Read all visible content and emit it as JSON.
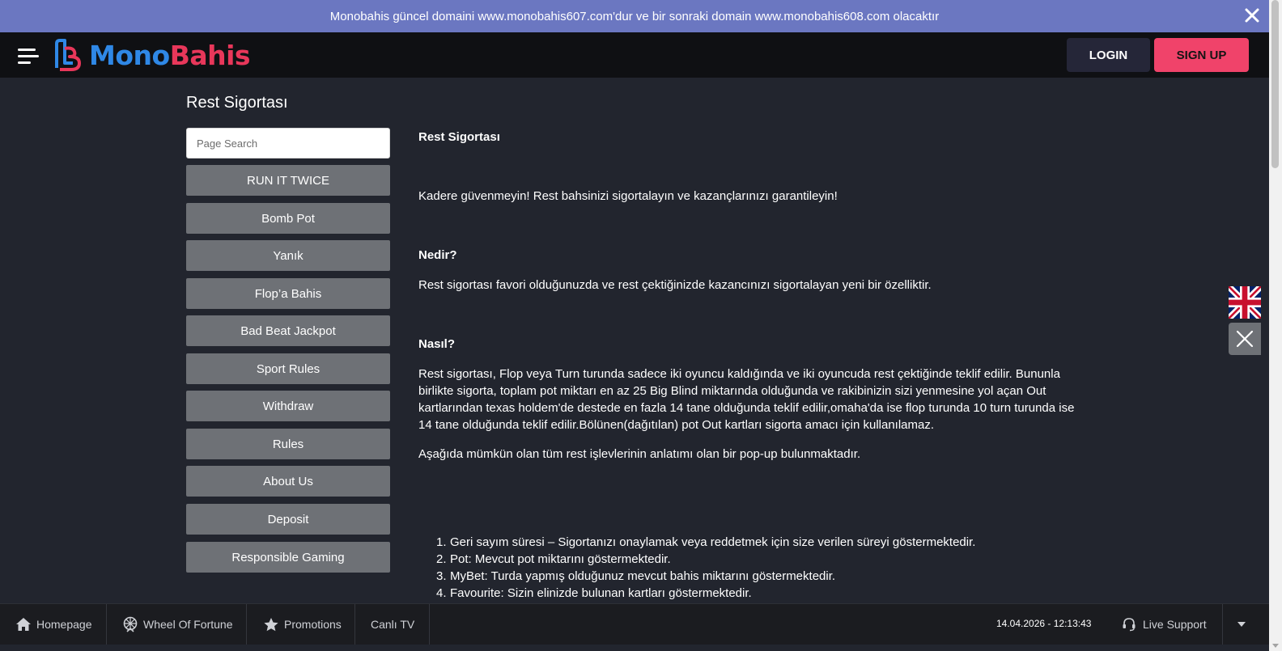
{
  "announcement": {
    "text": "Monobahis güncel domaini www.monobahis607.com'dur ve bir sonraki domain www.monobahis608.com olacaktır"
  },
  "header": {
    "logo_part1": "Mono",
    "logo_part2": "Bahis",
    "login_label": "LOGIN",
    "signup_label": "SIGN UP"
  },
  "page": {
    "title": "Rest Sigortası"
  },
  "sidebar": {
    "search_placeholder": "Page Search",
    "items": [
      {
        "label": "RUN IT TWICE"
      },
      {
        "label": "Bomb Pot"
      },
      {
        "label": "Yanık"
      },
      {
        "label": "Flop’a Bahis"
      },
      {
        "label": "Bad Beat Jackpot"
      },
      {
        "label": "Sport Rules"
      },
      {
        "label": "Withdraw"
      },
      {
        "label": "Rules"
      },
      {
        "label": "About Us"
      },
      {
        "label": "Deposit"
      },
      {
        "label": "Responsible Gaming"
      }
    ]
  },
  "content": {
    "heading": "Rest Sigortası",
    "intro": "Kadere güvenmeyin! Rest bahsinizi sigortalayın ve kazançlarınızı garantileyin!",
    "what_heading": "Nedir?",
    "what_text": "Rest sigortası favori olduğunuzda ve rest çektiğinizde kazancınızı sigortalayan yeni bir özelliktir.",
    "how_heading": "Nasıl?",
    "how_lines": [
      "Rest sigortası, Flop veya Turn turunda sadece iki oyuncu kaldığında ve iki oyuncuda rest çektiğinde teklif edilir. Bununla",
      "birlikte sigorta, toplam pot miktarı en az 25 Big Blind miktarında olduğunda ve rakibinizin sizi yenmesine yol açan Out",
      "kartlarından texas holdem'de destede en fazla 14 tane olduğunda teklif edilir,omaha'da ise flop turunda 10 turn turunda ise",
      "14 tane olduğunda teklif edilir.Bölünen(dağıtılan) pot Out kartları sigorta amacı için kullanılamaz."
    ],
    "popup_text": "Aşağıda mümkün olan tüm rest işlevlerinin anlatımı olan bir pop-up bulunmaktadır.",
    "list": [
      {
        "num": "1.",
        "text": "Geri sayım süresi – Sigortanızı onaylamak veya reddetmek için size verilen süreyi göstermektedir."
      },
      {
        "num": "2.",
        "text": "Pot: Mevcut pot miktarını göstermektedir."
      },
      {
        "num": "3.",
        "text": "MyBet: Turda yapmış olduğunuz mevcut bahis miktarını göstermektedir."
      },
      {
        "num": "4.",
        "text": "Favourite: Sizin elinizde bulunan kartları göstermektedir."
      }
    ]
  },
  "bottom_bar": {
    "homepage": "Homepage",
    "wheel": "Wheel Of Fortune",
    "promotions": "Promotions",
    "canli_tv": "Canlı TV",
    "datetime": "14.04.2026 - 12:13:43",
    "live_support": "Live Support"
  },
  "colors": {
    "announcement_bg": "#6b77c1",
    "header_bg": "#0f1013",
    "page_bg": "#22252e",
    "sidebar_button": "#6e7176",
    "login_bg": "#252638",
    "signup_bg": "#f0436a",
    "logo_blue": "#2f88e6",
    "logo_red": "#e8375a"
  },
  "icons": {
    "announcement_close": "close-icon",
    "menu": "hamburger-icon",
    "language": "uk-flag-icon",
    "float_close": "close-icon",
    "homepage": "home-icon",
    "wheel": "wheel-icon",
    "promotions": "star-icon",
    "live_support": "headset-icon",
    "expand": "chevron-down-icon"
  }
}
